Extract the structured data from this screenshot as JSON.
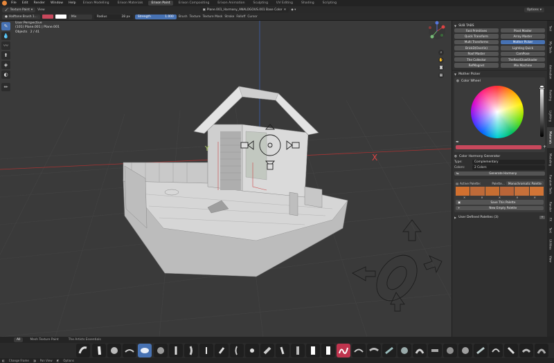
{
  "menu": [
    "File",
    "Edit",
    "Render",
    "Window",
    "Help"
  ],
  "workspaces": [
    {
      "label": "Erixon Modelling",
      "active": false
    },
    {
      "label": "Erixon Materials",
      "active": false
    },
    {
      "label": "Erixon Paint",
      "active": true
    },
    {
      "label": "Erixon Compositing",
      "active": false
    },
    {
      "label": "Erixon Animation",
      "active": false
    },
    {
      "label": "Sculpting",
      "active": false
    },
    {
      "label": "UV Editing",
      "active": false
    },
    {
      "label": "Shading",
      "active": false
    },
    {
      "label": "Scripting",
      "active": false
    }
  ],
  "header1": {
    "mode": "Texture Paint",
    "view": "View",
    "image_name": "Plane.001_Harmony_ANALOGOUS.001 Base Color",
    "options": "Options"
  },
  "header2": {
    "brush_name": "Halftone Brush 1...",
    "blend": "Mix",
    "radius_label": "Radius",
    "radius_value": "28 px",
    "strength_label": "Strength",
    "strength_value": "1.000",
    "menus": [
      "Brush",
      "Texture",
      "Texture Mask",
      "Stroke",
      "Falloff",
      "Cursor"
    ]
  },
  "viewport": {
    "perspective": "User Perspective",
    "object": "(101) Plane.001 | Plane.001",
    "objects_label": "Objects",
    "objects_count": "2 / 41",
    "axis_y": "Y",
    "axis_x": "X"
  },
  "sidebar": {
    "sub_tabs_title": "SUB TABS",
    "sub_tabs": [
      {
        "label": "Fast Primitives",
        "active": false
      },
      {
        "label": "Pivot Master",
        "active": false
      },
      {
        "label": "Quick Transform",
        "active": false
      },
      {
        "label": "Array Master",
        "active": false
      },
      {
        "label": "Multi Transforms",
        "active": false
      },
      {
        "label": "Mother Picker",
        "active": true
      },
      {
        "label": "BrickD(Overlin)",
        "active": false
      },
      {
        "label": "Lighting Quick",
        "active": false
      },
      {
        "label": "Roof Master",
        "active": false
      },
      {
        "label": "CamPose",
        "active": false
      },
      {
        "label": "The Collector",
        "active": false
      },
      {
        "label": "TheRealGlowShader",
        "active": false
      },
      {
        "label": "RefMagnet",
        "active": false
      },
      {
        "label": "Mix Machine",
        "active": false
      }
    ],
    "mother_picker_title": "Mother Picker",
    "color_wheel_title": "Color Wheel",
    "current_color": "#c8485c",
    "harmony_title": "Color Harmony Generator",
    "type_label": "Type:",
    "type_value": "Complementary",
    "colors_label": "Colors:",
    "colors_value": "2 Colors",
    "generate_label": "Generate Harmony",
    "active_palette_label": "Active Palette:",
    "palette_name": "Palette...",
    "palette_mode": "Monochromatic Palette",
    "palette_colors": [
      "#d2702f",
      "#bd6a39",
      "#c66e32",
      "#b96538",
      "#c5703a",
      "#d07436"
    ],
    "save_palette": "Save This Palette",
    "new_palette": "New Empty Palette",
    "user_palettes": "User Defined Palettes (3)"
  },
  "side_tabs": [
    "Tool",
    "My Tools",
    "Animation",
    "Painting",
    "Lighting",
    "Materials",
    "Modeling",
    "Random Tools",
    "Render",
    "FX",
    "Text",
    "Utilities",
    "View"
  ],
  "shelf": {
    "tabs": [
      {
        "label": "All",
        "active": true
      },
      {
        "label": "Mesh Texture Paint",
        "active": false
      },
      {
        "label": "The Artists Essentials",
        "active": false
      }
    ]
  },
  "status": {
    "items": [
      "Change Frame",
      "Pan View",
      "Options"
    ]
  }
}
